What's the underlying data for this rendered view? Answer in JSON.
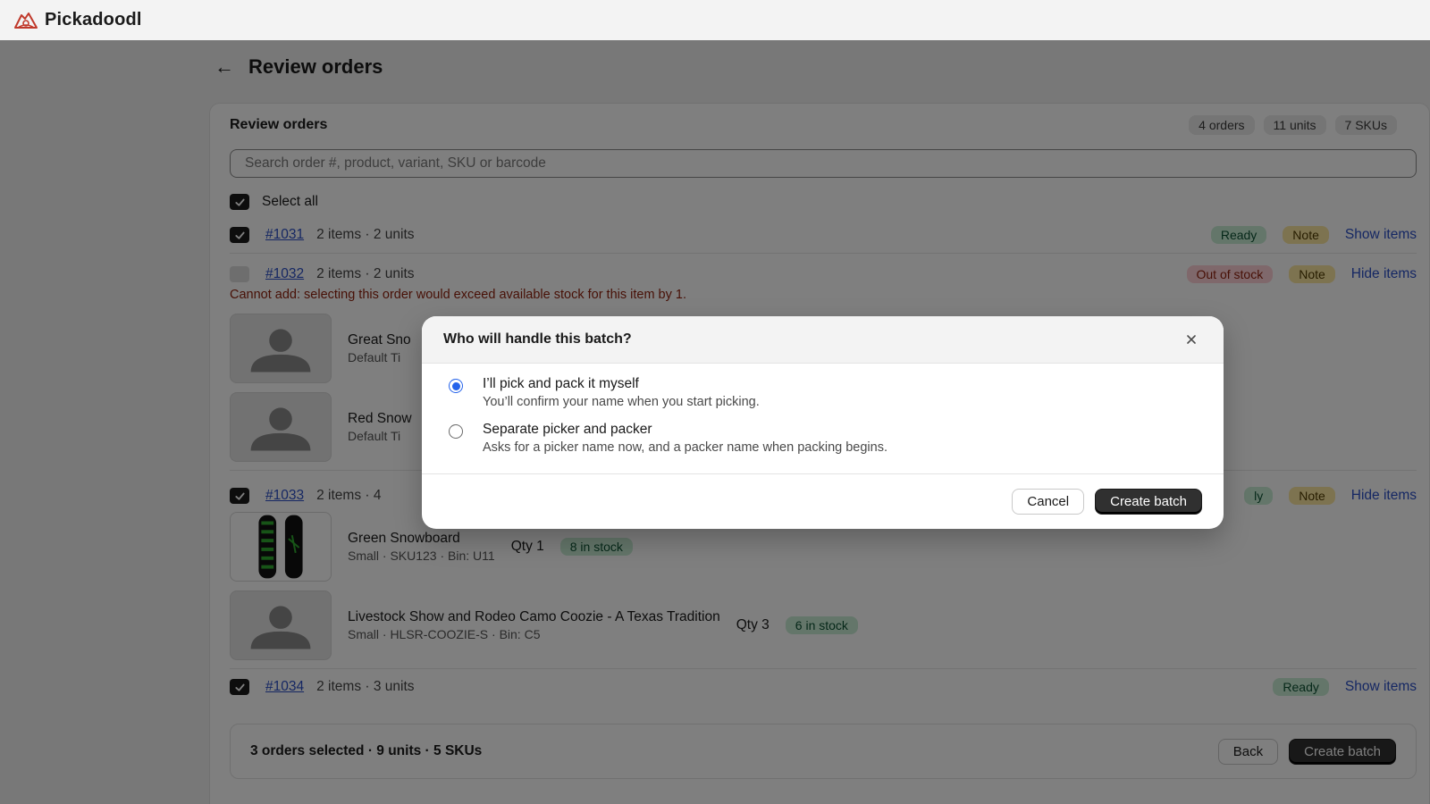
{
  "app": {
    "brand": "Pickadoodl"
  },
  "page": {
    "title": "Review orders",
    "back_icon": "arrow-left-icon"
  },
  "card": {
    "title": "Review orders",
    "chips": [
      "4 orders",
      "11 units",
      "7 SKUs"
    ],
    "search": {
      "placeholder": "Search order #, product, variant, SKU or barcode",
      "value": ""
    },
    "select_all": {
      "label": "Select all",
      "checked": true
    }
  },
  "orders": [
    {
      "number": "#1031",
      "meta": "2 items · 2 units",
      "checked": true,
      "badges": [
        "Ready",
        "Note"
      ],
      "toggle": "Show items"
    },
    {
      "number": "#1032",
      "meta": "2 items · 2 units",
      "checked": false,
      "disabled": true,
      "badges": [
        "Out of stock",
        "Note"
      ],
      "toggle": "Hide items",
      "error": "Cannot add: selecting this order would exceed available stock for this item by 1.",
      "items": [
        {
          "name": "Great Sno",
          "sub": "Default Ti"
        },
        {
          "name": "Red Snow",
          "sub": "Default Ti"
        }
      ]
    },
    {
      "number": "#1033",
      "meta": "2 items · 4",
      "checked": true,
      "badges": [
        "ly",
        "Note"
      ],
      "toggle": "Hide items",
      "items": [
        {
          "name": "Green Snowboard",
          "sub": "Small · SKU123 · Bin: U11",
          "qty": "Qty 1",
          "stock": "8 in stock"
        },
        {
          "name": "Livestock Show and Rodeo Camo Coozie - A Texas Tradition",
          "sub": "Small · HLSR-COOZIE-S · Bin: C5",
          "qty": "Qty 3",
          "stock": "6 in stock"
        }
      ]
    },
    {
      "number": "#1034",
      "meta": "2 items · 3 units",
      "checked": true,
      "badges": [
        "Ready"
      ],
      "toggle": "Show items"
    }
  ],
  "footer": {
    "summary": "3 orders selected · 9 units · 5 SKUs",
    "back": "Back",
    "create": "Create batch"
  },
  "modal": {
    "title": "Who will handle this batch?",
    "options": [
      {
        "label": "I’ll pick and pack it myself",
        "help": "You’ll confirm your name when you start picking.",
        "selected": true
      },
      {
        "label": "Separate picker and packer",
        "help": "Asks for a picker name now, and a packer name when packing begins.",
        "selected": false
      }
    ],
    "cancel": "Cancel",
    "create": "Create batch"
  },
  "colors": {
    "accent_radio": "#2563eb",
    "link": "#2b4fc6",
    "primary_button": "#303030",
    "error": "#8e1f0b"
  }
}
